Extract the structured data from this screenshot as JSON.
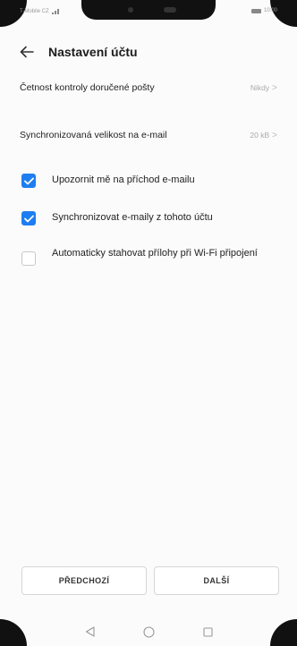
{
  "status_bar": {
    "carrier": "T-Mobile CZ",
    "time": "10:00"
  },
  "header": {
    "title": "Nastavení účtu"
  },
  "settings": [
    {
      "label": "Četnost kontroly doručené pošty",
      "value": "Nikdy"
    },
    {
      "label": "Synchronizovaná velikost na e-mail",
      "value": "20 kB"
    }
  ],
  "options": [
    {
      "label": "Upozornit mě na příchod e-mailu",
      "checked": true
    },
    {
      "label": "Synchronizovat e-maily z tohoto účtu",
      "checked": true
    },
    {
      "label": "Automaticky stahovat přílohy při Wi-Fi připojení",
      "checked": false
    }
  ],
  "buttons": {
    "previous": "PŘEDCHOZÍ",
    "next": "DALŠÍ"
  },
  "colors": {
    "accent": "#1e7df0"
  },
  "icons": {
    "back": "back-arrow-icon",
    "nav_back": "triangle-back-icon",
    "nav_home": "circle-home-icon",
    "nav_recent": "square-recent-icon"
  }
}
